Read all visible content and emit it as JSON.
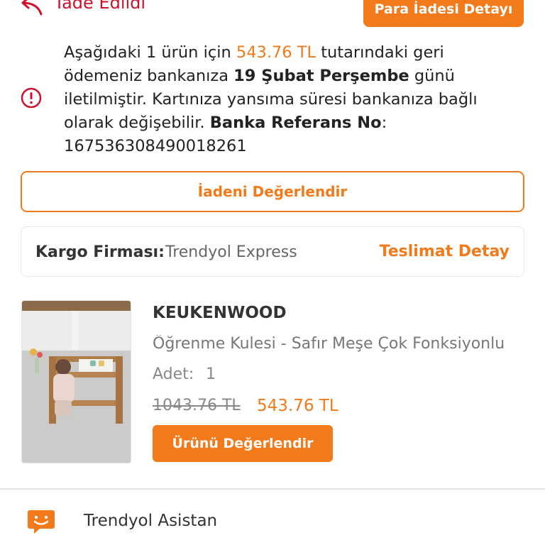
{
  "header": {
    "status_text": "İade Edildi",
    "refund_detail_button": "Para İadesi Detayı"
  },
  "refund_info": {
    "p1": "Aşağıdaki 1 ürün için ",
    "amount": "543.76 TL",
    "p2": " tutarındaki geri ödemeniz bankanıza ",
    "date": "19 Şubat Perşembe",
    "p3": " günü iletilmiştir. Kartınıza yansıma süresi bankanıza bağlı olarak değişebilir. ",
    "ref_label": "Banka Referans No",
    "p4": ": ",
    "ref_no": "167536308490018261"
  },
  "review_return_button": "İadeni Değerlendir",
  "cargo": {
    "label": "Kargo Firması:",
    "company": "Trendyol Express",
    "delivery_detail_link": "Teslimat Detay"
  },
  "product": {
    "brand": "KEUKENWOOD",
    "name": "Öğrenme Kulesi - Safır Meşe Çok Fonksiyonlu",
    "quantity_label": "Adet:",
    "quantity": "1",
    "old_price": "1043.76 TL",
    "price": "543.76 TL",
    "review_button": "Ürünü Değerlendir"
  },
  "assistant": {
    "label": "Trendyol Asistan"
  },
  "colors": {
    "accent": "#f27a1a",
    "status_red": "#d0112b"
  }
}
